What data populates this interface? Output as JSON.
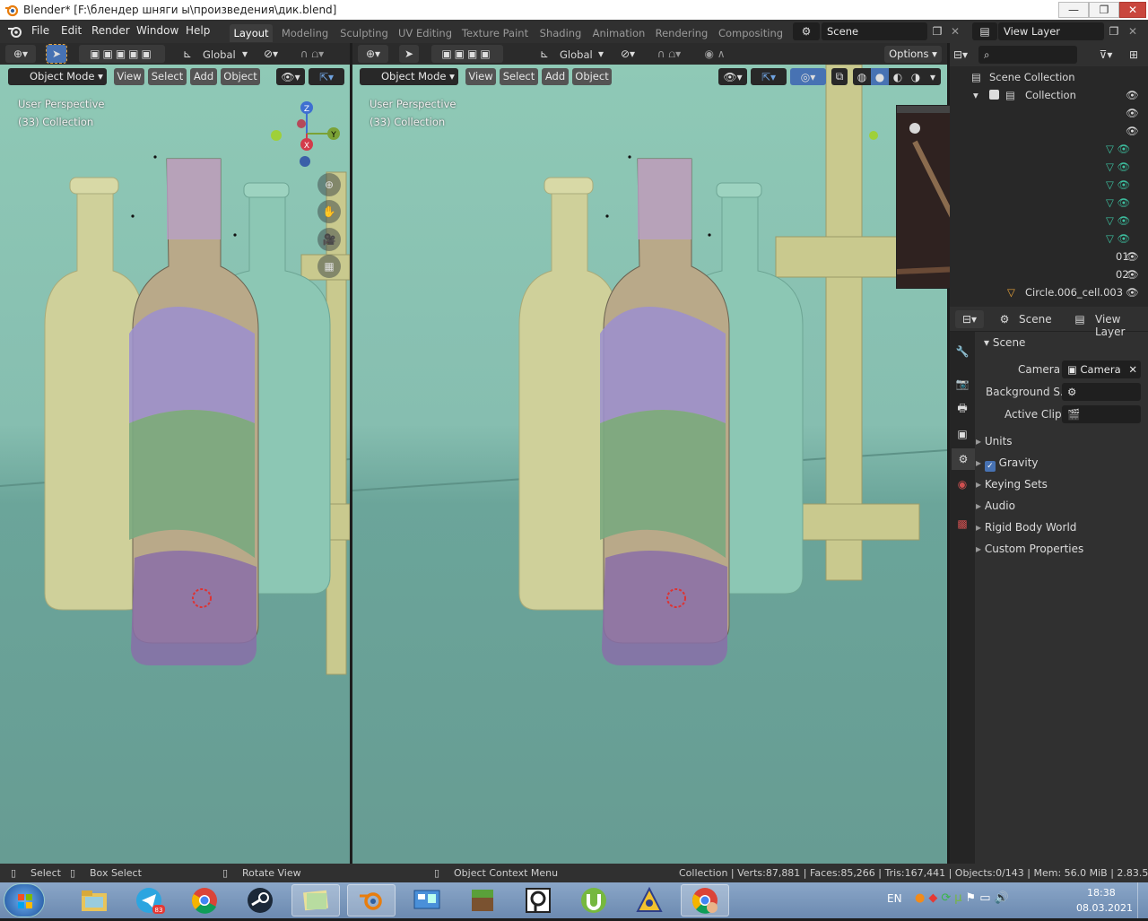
{
  "window": {
    "title": "Blender* [F:\\блендер шняги ы\\произведения\\дик.blend]",
    "minimize": "—",
    "maximize": "❐",
    "close": "✕"
  },
  "topbar": {
    "menus": [
      "File",
      "Edit",
      "Render",
      "Window",
      "Help"
    ],
    "workspaces": [
      "Layout",
      "Modeling",
      "Sculpting",
      "UV Editing",
      "Texture Paint",
      "Shading",
      "Animation",
      "Rendering",
      "Compositing"
    ],
    "active_workspace": "Layout",
    "scene_name": "Scene",
    "view_layer_name": "View Layer"
  },
  "viewport_left": {
    "orientation": "Global",
    "mode": "Object Mode",
    "menus": [
      "View",
      "Select",
      "Add",
      "Object"
    ],
    "perspective": "User Perspective",
    "collection": "(33) Collection",
    "gizmo_axes": [
      "Z",
      "Y",
      "X"
    ]
  },
  "viewport_right": {
    "orientation": "Global",
    "options_label": "Options",
    "mode": "Object Mode",
    "menus": [
      "View",
      "Select",
      "Add",
      "Object"
    ],
    "perspective": "User Perspective",
    "collection": "(33) Collection"
  },
  "outliner": {
    "items": [
      {
        "label": "Scene Collection"
      },
      {
        "label": "Collection"
      },
      {
        "label": "01"
      },
      {
        "label": "02"
      },
      {
        "label": "Circle.006_cell.003"
      }
    ]
  },
  "properties": {
    "header_scene": "Scene",
    "header_view_layer": "View Layer",
    "panel_title": "Scene",
    "camera_label": "Camera",
    "camera_value": "Camera",
    "background_label": "Background S...",
    "active_clip_label": "Active Clip",
    "subpanels": [
      {
        "label": "Units",
        "checkbox": false
      },
      {
        "label": "Gravity",
        "checkbox": true
      },
      {
        "label": "Keying Sets",
        "checkbox": false
      },
      {
        "label": "Audio",
        "checkbox": false
      },
      {
        "label": "Rigid Body World",
        "checkbox": false
      },
      {
        "label": "Custom Properties",
        "checkbox": false
      }
    ]
  },
  "statusbar": {
    "select": "Select",
    "box_select": "Box Select",
    "rotate_view": "Rotate View",
    "context_menu": "Object Context Menu",
    "stats": "Collection | Verts:87,881 | Faces:85,266 | Tris:167,441 | Objects:0/143 | Mem: 56.0 MiB | 2.83.5"
  },
  "taskbar": {
    "telegram_badge": "83",
    "language": "EN",
    "time": "18:38",
    "date": "08.03.2021"
  },
  "colors": {
    "accent_blue": "#4772b3",
    "viewport_bg": "#8fc9b6",
    "outliner_bg": "#282828"
  }
}
